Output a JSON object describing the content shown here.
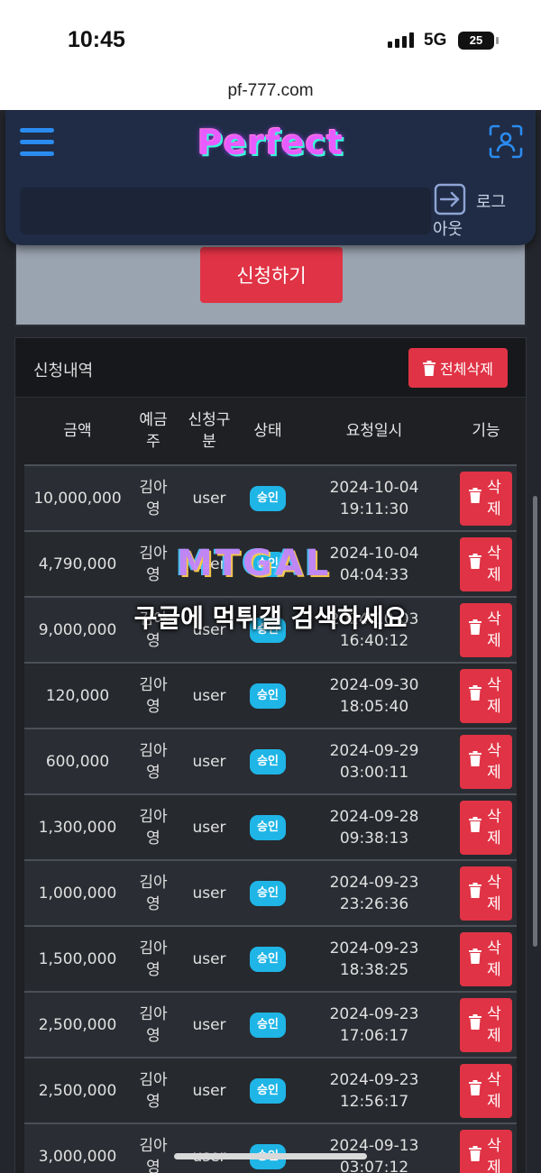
{
  "status_bar": {
    "time": "10:45",
    "network": "5G",
    "battery": "25"
  },
  "browser": {
    "url": "pf-777.com"
  },
  "header": {
    "logo": "Perfect",
    "logout_label_line1": "로그",
    "logout_label_line2": "아웃"
  },
  "apply": {
    "button_label": "신청하기"
  },
  "history": {
    "title": "신청내역",
    "delete_all_label": "전체삭제",
    "columns": {
      "amount": "금액",
      "depositor_line1": "예금",
      "depositor_line2": "주",
      "type_line1": "신청구",
      "type_line2": "분",
      "status": "상태",
      "datetime": "요청일시",
      "function": "기능"
    },
    "delete_label_line1": "삭",
    "delete_label_line2": "제",
    "rows": [
      {
        "amount": "10,000,000",
        "name_line1": "김아",
        "name_line2": "영",
        "type": "user",
        "status": "승인",
        "date": "2024-10-04",
        "time": "19:11:30"
      },
      {
        "amount": "4,790,000",
        "name_line1": "김아",
        "name_line2": "영",
        "type": "user",
        "status": "승인",
        "date": "2024-10-04",
        "time": "04:04:33"
      },
      {
        "amount": "9,000,000",
        "name_line1": "김아",
        "name_line2": "영",
        "type": "user",
        "status": "승인",
        "date": "2024-10-03",
        "time": "16:40:12"
      },
      {
        "amount": "120,000",
        "name_line1": "김아",
        "name_line2": "영",
        "type": "user",
        "status": "승인",
        "date": "2024-09-30",
        "time": "18:05:40"
      },
      {
        "amount": "600,000",
        "name_line1": "김아",
        "name_line2": "영",
        "type": "user",
        "status": "승인",
        "date": "2024-09-29",
        "time": "03:00:11"
      },
      {
        "amount": "1,300,000",
        "name_line1": "김아",
        "name_line2": "영",
        "type": "user",
        "status": "승인",
        "date": "2024-09-28",
        "time": "09:38:13"
      },
      {
        "amount": "1,000,000",
        "name_line1": "김아",
        "name_line2": "영",
        "type": "user",
        "status": "승인",
        "date": "2024-09-23",
        "time": "23:26:36"
      },
      {
        "amount": "1,500,000",
        "name_line1": "김아",
        "name_line2": "영",
        "type": "user",
        "status": "승인",
        "date": "2024-09-23",
        "time": "18:38:25"
      },
      {
        "amount": "2,500,000",
        "name_line1": "김아",
        "name_line2": "영",
        "type": "user",
        "status": "승인",
        "date": "2024-09-23",
        "time": "17:06:17"
      },
      {
        "amount": "2,500,000",
        "name_line1": "김아",
        "name_line2": "영",
        "type": "user",
        "status": "승인",
        "date": "2024-09-23",
        "time": "12:56:17"
      },
      {
        "amount": "3,000,000",
        "name_line1": "김아",
        "name_line2": "영",
        "type": "user",
        "status": "승인",
        "date": "2024-09-13",
        "time": "03:07:12"
      }
    ]
  },
  "watermark": {
    "logo": "MTGAL",
    "text": "구글에 먹튀갤 검색하세요"
  },
  "colors": {
    "danger": "#e03345",
    "badge": "#1fb5e6",
    "nav": "#202c45",
    "accent": "#2a8cf0"
  }
}
